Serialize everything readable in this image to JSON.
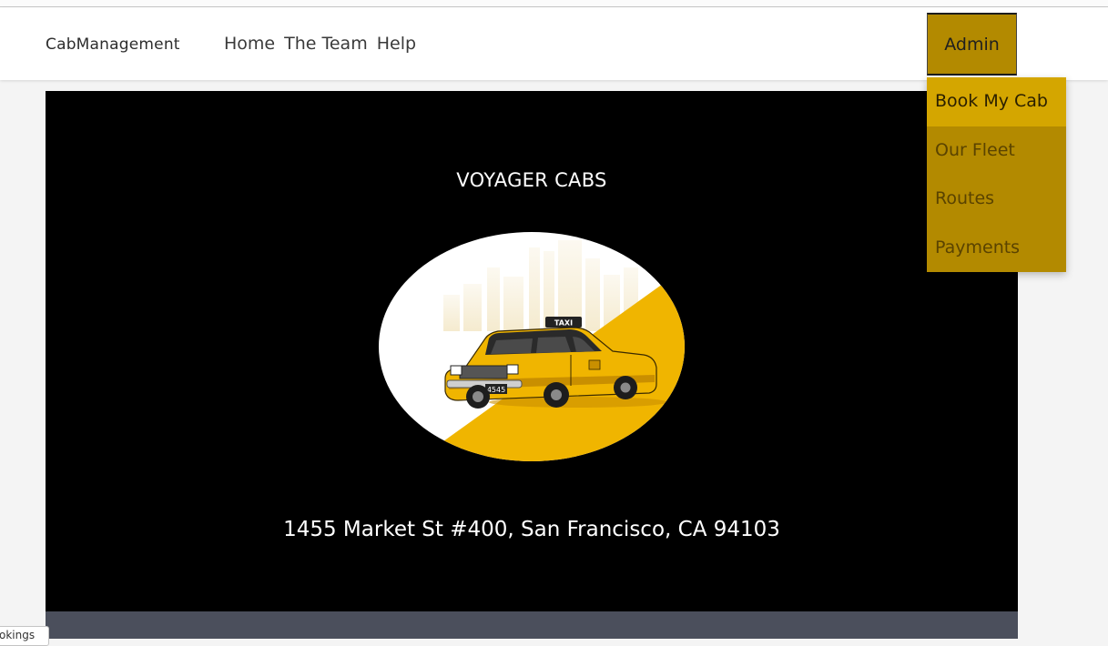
{
  "navbar": {
    "brand": "CabManagement",
    "links": [
      {
        "label": "Home"
      },
      {
        "label": "The Team"
      },
      {
        "label": "Help"
      }
    ],
    "admin_label": "Admin"
  },
  "dropdown": {
    "items": [
      {
        "label": "Book My Cab",
        "active": true
      },
      {
        "label": "Our Fleet"
      },
      {
        "label": "Routes"
      },
      {
        "label": "Payments"
      }
    ]
  },
  "hero": {
    "title": "VOYAGER CABS",
    "address": "1455 Market St #400, San Francisco, CA 94103",
    "taxi_sign": "TAXI",
    "plate": "4545"
  },
  "bottom_left_tab": "okings",
  "colors": {
    "accent": "#b38a00",
    "accent_active": "#d4a600",
    "taxi_yellow": "#f0b500",
    "hero_bg": "#000000",
    "footer_strip": "#4b4f5c"
  },
  "icons": {
    "hero_logo": "taxi-cab-illustration"
  }
}
